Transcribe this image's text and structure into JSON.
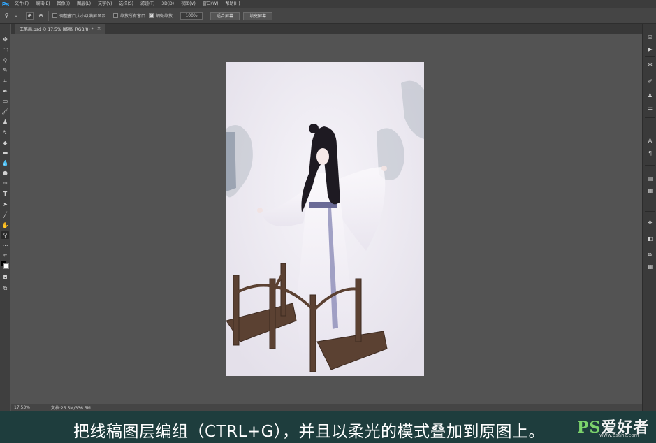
{
  "app": {
    "logo": "Ps"
  },
  "menu": [
    "文件(F)",
    "编辑(E)",
    "图像(I)",
    "图层(L)",
    "文字(Y)",
    "选择(S)",
    "滤镜(T)",
    "3D(D)",
    "视图(V)",
    "窗口(W)",
    "帮助(H)"
  ],
  "options": {
    "resize_windows": "调整窗口大小以满屏显示",
    "zoom_all": "缩放所有窗口",
    "scrubby_zoom": "细微缩放",
    "zoom_value": "100%",
    "fit_screen": "适合屏幕",
    "fill_screen": "填充屏幕"
  },
  "document": {
    "tab_label": "工笔画.psd @ 17.5% (线稿, RGB/8) *"
  },
  "status": {
    "zoom": "17.53%",
    "doc_size": "文档:25.5M/336.5M"
  },
  "caption": {
    "text": "把线稿图层编组（CTRL+G），并且以柔光的模式叠加到原图上。"
  },
  "watermark": {
    "logo_ps": "PS",
    "logo_text": "爱好者",
    "url": "www.psahz.com"
  },
  "colors": {
    "ui_bg": "#535353",
    "accent": "#31a8ff",
    "caption_bg": "#1e3d3d"
  }
}
